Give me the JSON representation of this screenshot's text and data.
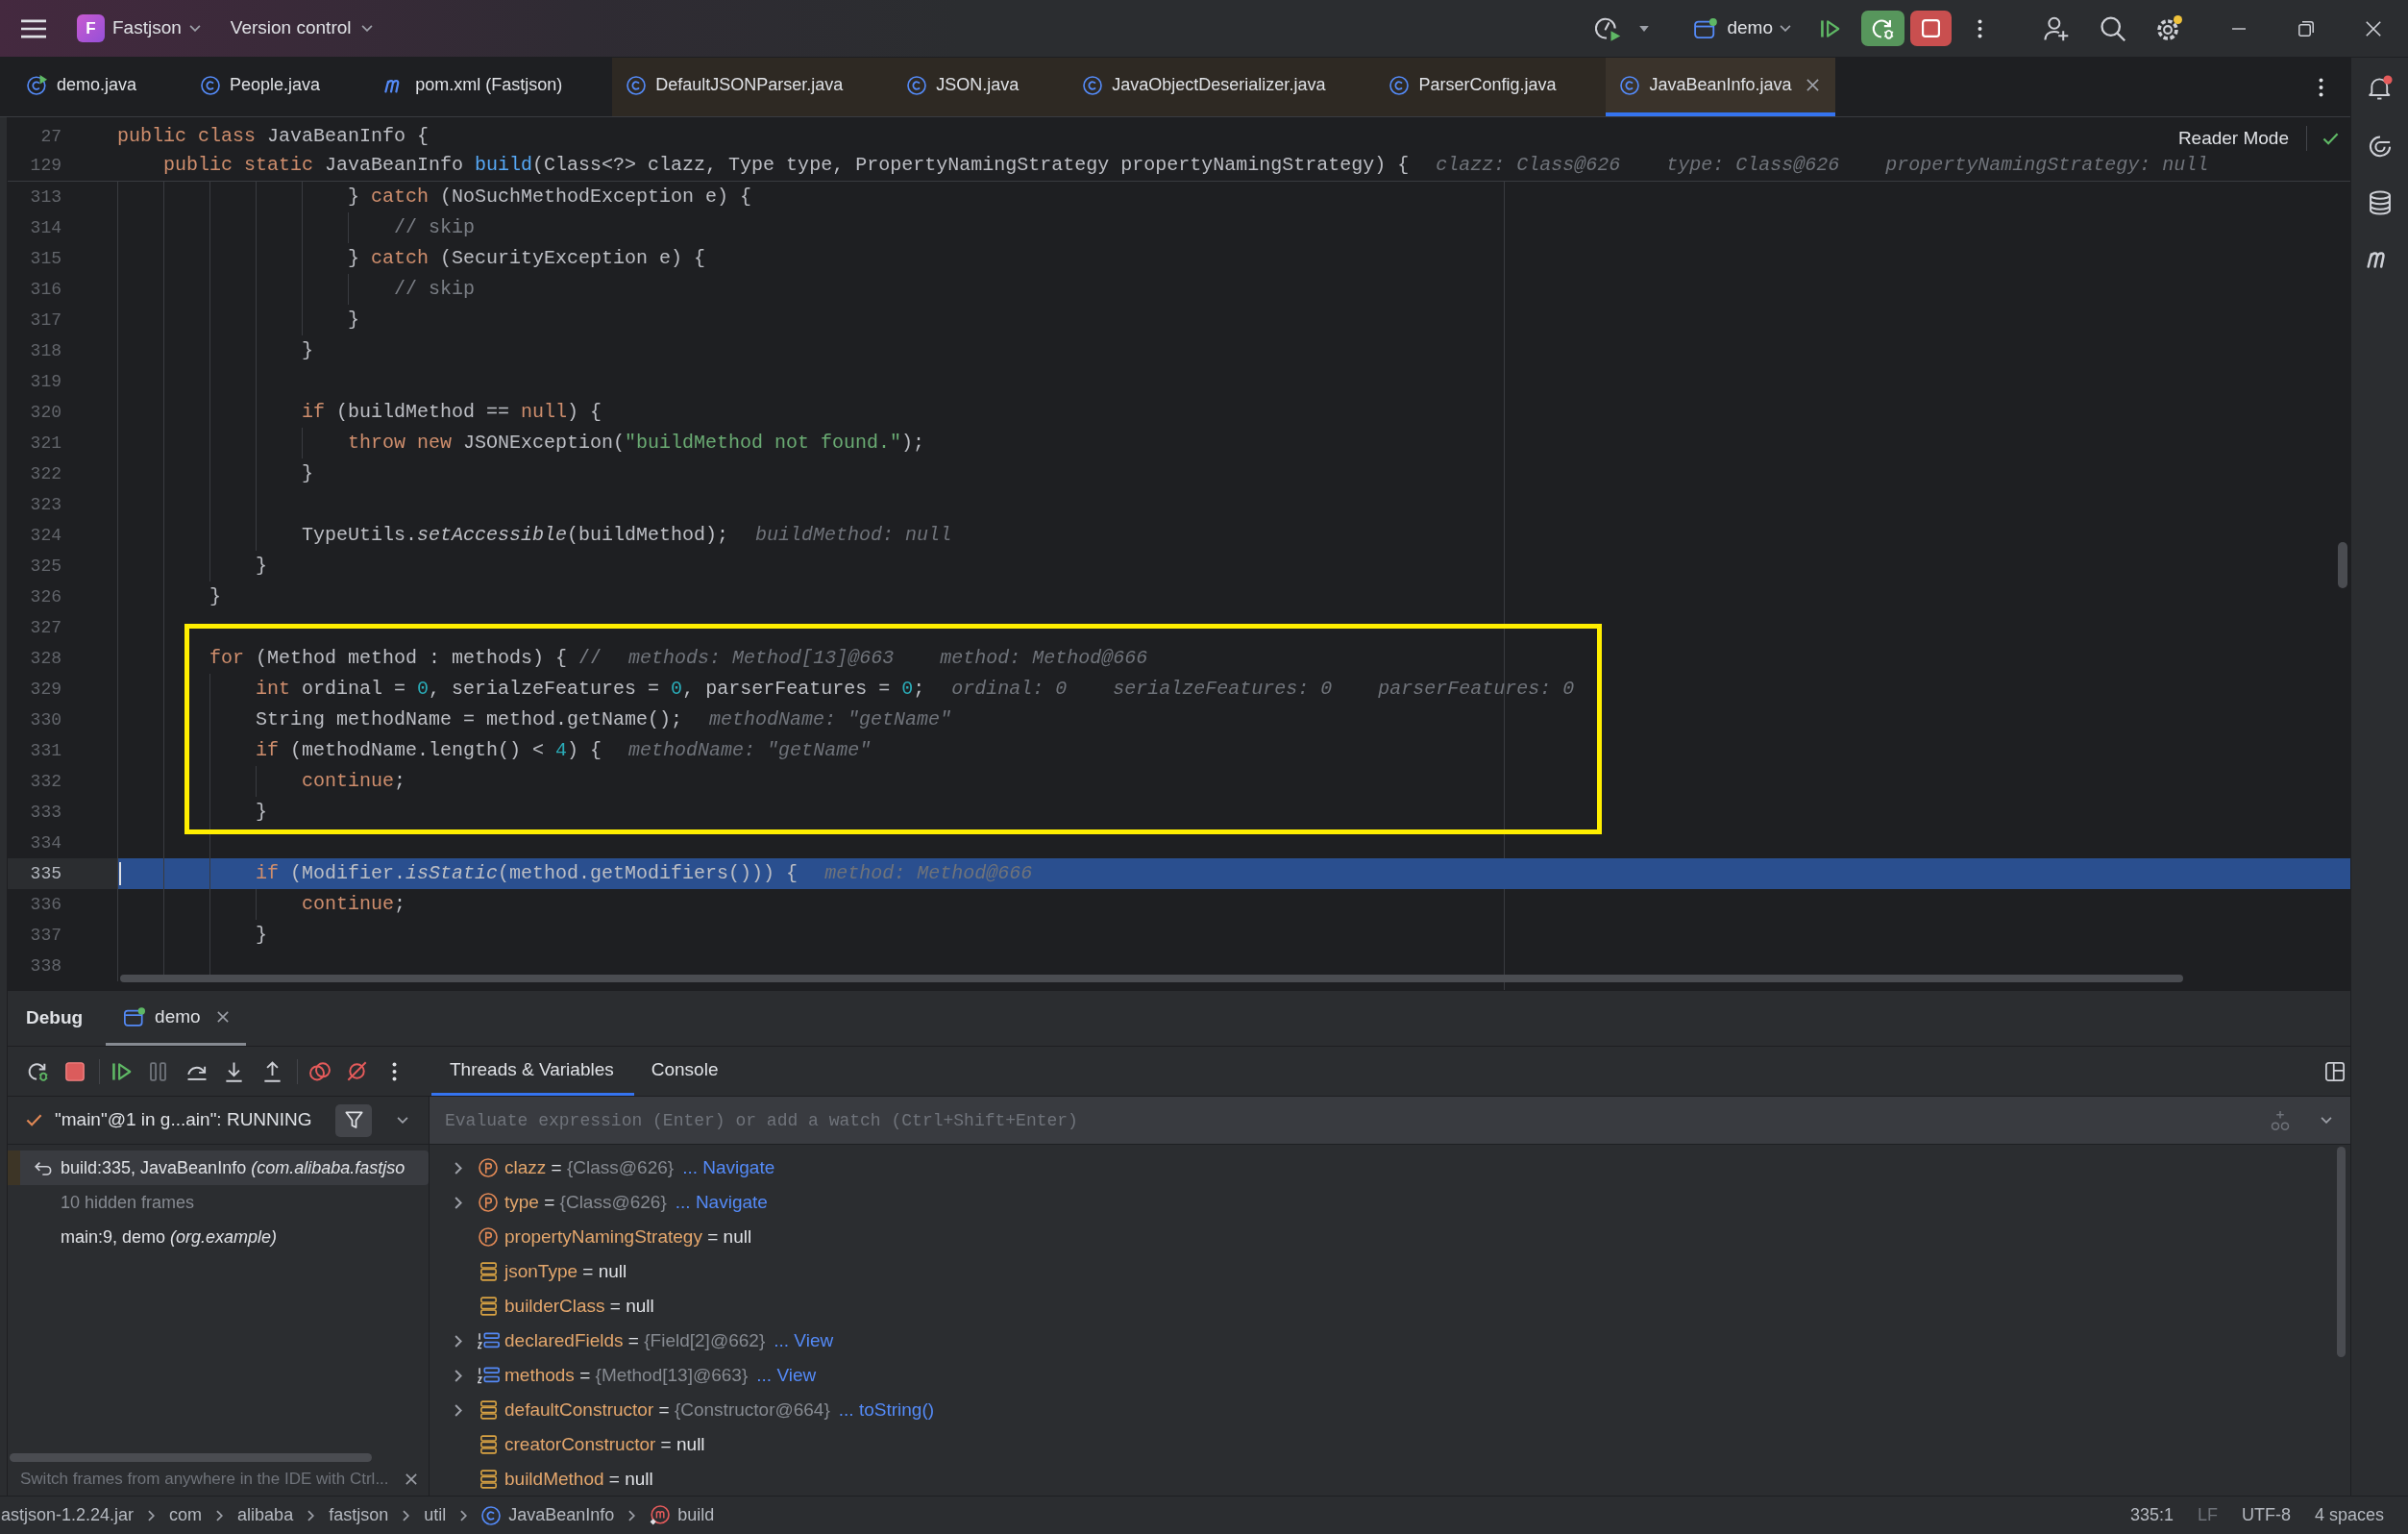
{
  "title_bar": {
    "project_badge": "F",
    "project": "Fastjson",
    "vcs": "Version control",
    "run_config": "demo"
  },
  "tabs": [
    {
      "label": "demo.java",
      "kind": "runnable_class",
      "library": false,
      "selected": false
    },
    {
      "label": "People.java",
      "kind": "class",
      "library": false,
      "selected": false
    },
    {
      "label": "pom.xml (Fastjson)",
      "kind": "maven",
      "library": false,
      "selected": false
    },
    {
      "label": "DefaultJSONParser.java",
      "kind": "class",
      "library": true,
      "selected": false
    },
    {
      "label": "JSON.java",
      "kind": "class",
      "library": true,
      "selected": false
    },
    {
      "label": "JavaObjectDeserializer.java",
      "kind": "class",
      "library": true,
      "selected": false
    },
    {
      "label": "ParserConfig.java",
      "kind": "class",
      "library": true,
      "selected": false
    },
    {
      "label": "JavaBeanInfo.java",
      "kind": "class",
      "library": true,
      "selected": true
    }
  ],
  "editor": {
    "reader_mode": "Reader Mode",
    "sticky_lines": [
      {
        "number": "27",
        "code": [
          {
            "kind": "keyword",
            "text": "public class"
          },
          {
            "kind": "plain",
            "text": " JavaBeanInfo {"
          }
        ]
      },
      {
        "number": "129",
        "code": [
          {
            "kind": "keyword",
            "text": "    public static"
          },
          {
            "kind": "plain",
            "text": " JavaBeanInfo "
          },
          {
            "kind": "declaration",
            "text": "build"
          },
          {
            "kind": "plain",
            "text": "(Class<?> clazz, Type type, PropertyNamingStrategy propertyNamingStrategy) {"
          }
        ],
        "hints": [
          "clazz: Class@626",
          "type: Class@626",
          "propertyNamingStrategy: null"
        ]
      }
    ],
    "lines": [
      {
        "kind": "line",
        "number": "313",
        "code": [
          {
            "kind": "plain",
            "text": "                    } "
          },
          {
            "kind": "keyword",
            "text": "catch"
          },
          {
            "kind": "plain",
            "text": " (NoSuchMethodException e) {"
          }
        ],
        "current": false
      },
      {
        "kind": "line",
        "number": "314",
        "code": [
          {
            "kind": "comment",
            "text": "                        // skip"
          }
        ],
        "current": false
      },
      {
        "kind": "line",
        "number": "315",
        "code": [
          {
            "kind": "plain",
            "text": "                    } "
          },
          {
            "kind": "keyword",
            "text": "catch"
          },
          {
            "kind": "plain",
            "text": " (SecurityException e) {"
          }
        ],
        "current": false
      },
      {
        "kind": "line",
        "number": "316",
        "code": [
          {
            "kind": "comment",
            "text": "                        // skip"
          }
        ],
        "current": false
      },
      {
        "kind": "line",
        "number": "317",
        "code": [
          {
            "kind": "plain",
            "text": "                    }"
          }
        ],
        "current": false
      },
      {
        "kind": "line",
        "number": "318",
        "code": [
          {
            "kind": "plain",
            "text": "                }"
          }
        ],
        "current": false
      },
      {
        "kind": "line",
        "number": "319",
        "current": false
      },
      {
        "kind": "line",
        "number": "320",
        "code": [
          {
            "kind": "keyword",
            "text": "                if"
          },
          {
            "kind": "plain",
            "text": " (buildMethod == "
          },
          {
            "kind": "keyword",
            "text": "null"
          },
          {
            "kind": "plain",
            "text": ") {"
          }
        ],
        "current": false
      },
      {
        "kind": "line",
        "number": "321",
        "code": [
          {
            "kind": "keyword",
            "text": "                    throw new"
          },
          {
            "kind": "plain",
            "text": " JSONException("
          },
          {
            "kind": "string",
            "text": "\"buildMethod not found.\""
          },
          {
            "kind": "plain",
            "text": ");"
          }
        ],
        "current": false
      },
      {
        "kind": "line",
        "number": "322",
        "code": [
          {
            "kind": "plain",
            "text": "                }"
          }
        ],
        "current": false
      },
      {
        "kind": "line",
        "number": "323",
        "current": false
      },
      {
        "kind": "line",
        "number": "324",
        "code": [
          {
            "kind": "plain",
            "text": "                TypeUtils."
          },
          {
            "kind": "static_call",
            "text": "setAccessible"
          },
          {
            "kind": "plain",
            "text": "(buildMethod);"
          }
        ],
        "hints": [
          "buildMethod: null"
        ],
        "current": false
      },
      {
        "kind": "line",
        "number": "325",
        "code": [
          {
            "kind": "plain",
            "text": "            }"
          }
        ],
        "current": false
      },
      {
        "kind": "line",
        "number": "326",
        "code": [
          {
            "kind": "plain",
            "text": "        }"
          }
        ],
        "current": false
      },
      {
        "kind": "line",
        "number": "327",
        "current": false
      },
      {
        "kind": "boxed",
        "lines": [
          {
            "number": "328",
            "code": [
              {
                "kind": "keyword",
                "text": "        for"
              },
              {
                "kind": "plain",
                "text": " (Method method : methods) { "
              },
              {
                "kind": "comment",
                "text": "//"
              }
            ],
            "hints": [
              "methods: Method[13]@663",
              "method: Method@666"
            ],
            "current": false
          },
          {
            "number": "329",
            "code": [
              {
                "kind": "keyword",
                "text": "            int"
              },
              {
                "kind": "plain",
                "text": " ordinal = "
              },
              {
                "kind": "number",
                "text": "0"
              },
              {
                "kind": "plain",
                "text": ", serialzeFeatures = "
              },
              {
                "kind": "number",
                "text": "0"
              },
              {
                "kind": "plain",
                "text": ", parserFeatures = "
              },
              {
                "kind": "number",
                "text": "0"
              },
              {
                "kind": "plain",
                "text": ";"
              }
            ],
            "hints": [
              "ordinal: 0",
              "serialzeFeatures: 0",
              "parserFeatures: 0"
            ],
            "current": false
          },
          {
            "number": "330",
            "code": [
              {
                "kind": "plain",
                "text": "            String methodName = method.getName();"
              }
            ],
            "hints": [
              "methodName: \"getName\""
            ],
            "current": false
          },
          {
            "number": "331",
            "code": [
              {
                "kind": "keyword",
                "text": "            if"
              },
              {
                "kind": "plain",
                "text": " (methodName.length() < "
              },
              {
                "kind": "number",
                "text": "4"
              },
              {
                "kind": "plain",
                "text": ") {"
              }
            ],
            "hints": [
              "methodName: \"getName\""
            ],
            "current": false
          },
          {
            "number": "332",
            "code": [
              {
                "kind": "keyword",
                "text": "                continue"
              },
              {
                "kind": "plain",
                "text": ";"
              }
            ],
            "current": false
          },
          {
            "number": "333",
            "code": [
              {
                "kind": "plain",
                "text": "            }"
              }
            ],
            "current": false
          }
        ]
      },
      {
        "kind": "line",
        "number": "334",
        "current": false
      },
      {
        "kind": "line",
        "number": "335",
        "code": [
          {
            "kind": "keyword",
            "text": "            if"
          },
          {
            "kind": "plain",
            "text": " (Modifier."
          },
          {
            "kind": "static_call",
            "text": "isStatic"
          },
          {
            "kind": "plain",
            "text": "(method.getModifiers())) {"
          }
        ],
        "hints": [
          "method: Method@666"
        ],
        "current": true
      },
      {
        "kind": "line",
        "number": "336",
        "code": [
          {
            "kind": "keyword",
            "text": "                continue"
          },
          {
            "kind": "plain",
            "text": ";"
          }
        ],
        "current": false
      },
      {
        "kind": "line",
        "number": "337",
        "code": [
          {
            "kind": "plain",
            "text": "            }"
          }
        ],
        "current": false
      },
      {
        "kind": "line",
        "number": "338",
        "current": false
      }
    ]
  },
  "debug": {
    "title": "Debug",
    "sessions": [
      {
        "label": "demo",
        "selected": true
      }
    ],
    "views": [
      {
        "label": "Threads & Variables",
        "selected": true
      },
      {
        "label": "Console",
        "selected": false
      }
    ],
    "thread": "\"main\"@1 in g...ain\": RUNNING",
    "frames": [
      {
        "kind": "current",
        "text": "build:335, JavaBeanInfo *(com.alibaba.fastjso*",
        "library": true,
        "selected": true
      },
      {
        "kind": "hidden",
        "text": "10 hidden frames",
        "library": false,
        "selected": false
      },
      {
        "kind": "frame",
        "text": "main:9, demo *(org.example)*",
        "library": false,
        "selected": false
      }
    ],
    "tip": "Switch frames from anywhere in the IDE with Ctrl...",
    "evaluate": {
      "placeholder": "Evaluate expression (Enter) or add a watch (Ctrl+Shift+Enter)"
    },
    "variables": [
      {
        "kind": "parameter",
        "expandable": true,
        "name": "clazz",
        "separator": "=",
        "value": "{Class@626}",
        "reference": true,
        "action": "... Navigate"
      },
      {
        "kind": "parameter",
        "expandable": true,
        "name": "type",
        "separator": "=",
        "value": "{Class@626}",
        "reference": true,
        "action": "... Navigate"
      },
      {
        "kind": "parameter",
        "expandable": false,
        "name": "propertyNamingStrategy",
        "separator": "=",
        "value": "null",
        "reference": false
      },
      {
        "kind": "local",
        "expandable": false,
        "name": "jsonType",
        "separator": "=",
        "value": "null",
        "reference": false
      },
      {
        "kind": "local",
        "expandable": false,
        "name": "builderClass",
        "separator": "=",
        "value": "null",
        "reference": false
      },
      {
        "kind": "array",
        "expandable": true,
        "name": "declaredFields",
        "separator": "=",
        "value": "{Field[2]@662}",
        "reference": true,
        "action": "... View"
      },
      {
        "kind": "array",
        "expandable": true,
        "name": "methods",
        "separator": "=",
        "value": "{Method[13]@663}",
        "reference": true,
        "action": "... View"
      },
      {
        "kind": "local",
        "expandable": true,
        "name": "defaultConstructor",
        "separator": "=",
        "value": "{Constructor@664}",
        "reference": true,
        "action": "... toString()"
      },
      {
        "kind": "local",
        "expandable": false,
        "name": "creatorConstructor",
        "separator": "=",
        "value": "null",
        "reference": false
      },
      {
        "kind": "local",
        "expandable": false,
        "name": "buildMethod",
        "separator": "=",
        "value": "null",
        "reference": false
      }
    ]
  },
  "status_bar": {
    "breadcrumbs": [
      {
        "kind": "plain",
        "label": "astjson-1.2.24.jar"
      },
      {
        "kind": "plain",
        "label": "com"
      },
      {
        "kind": "plain",
        "label": "alibaba"
      },
      {
        "kind": "plain",
        "label": "fastjson"
      },
      {
        "kind": "plain",
        "label": "util"
      },
      {
        "kind": "class",
        "label": "JavaBeanInfo"
      },
      {
        "kind": "method",
        "label": "build"
      }
    ],
    "items": [
      {
        "text": "335:1",
        "dimmed": false
      },
      {
        "text": "LF",
        "dimmed": true
      },
      {
        "text": "UTF-8",
        "dimmed": false
      },
      {
        "text": "4 spaces",
        "dimmed": false
      }
    ]
  }
}
